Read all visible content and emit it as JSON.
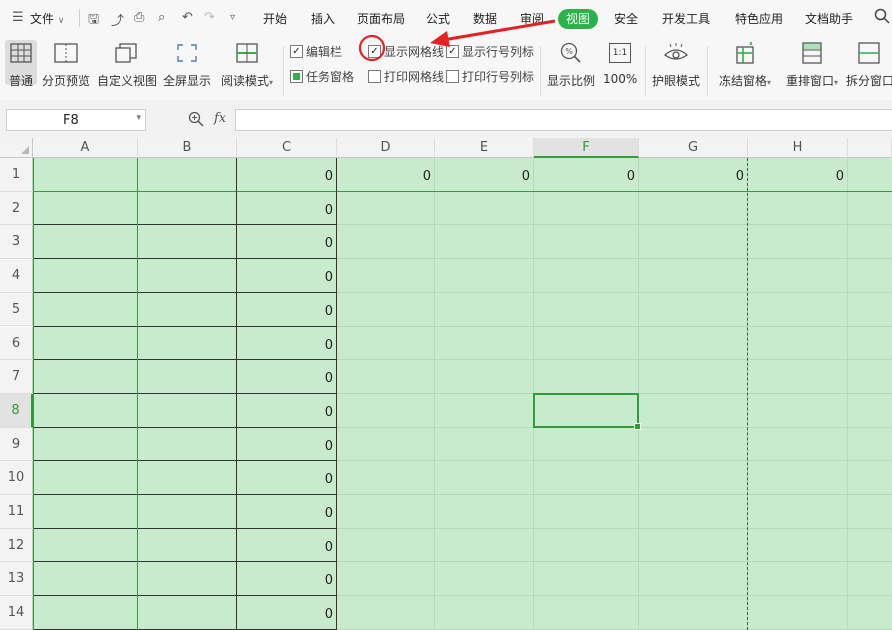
{
  "menubar": {
    "file_label": "文件",
    "tabs": [
      "开始",
      "插入",
      "页面布局",
      "公式",
      "数据",
      "审阅",
      "视图",
      "安全",
      "开发工具",
      "特色应用",
      "文档助手"
    ],
    "active_tab": "视图",
    "icons": [
      "menu-icon",
      "save-icon",
      "cloud-icon",
      "print-icon",
      "print-preview-icon",
      "undo-icon",
      "redo-icon",
      "customize-icon",
      "search-icon"
    ]
  },
  "ribbon": {
    "buttons": {
      "normal": "普通",
      "page_break": "分页预览",
      "custom_view": "自定义视图",
      "full_screen": "全屏显示",
      "reading_mode": "阅读模式",
      "zoom": "显示比例",
      "zoom_100": "100%",
      "eye_mode": "护眼模式",
      "freeze": "冻结窗格",
      "arrange": "重排窗口",
      "split": "拆分窗口"
    },
    "zoom_icon_text": "1:1",
    "checkboxes": {
      "formula_bar": {
        "label": "编辑栏",
        "checked": true
      },
      "show_gridlines": {
        "label": "显示网格线",
        "checked": true
      },
      "show_headers": {
        "label": "显示行号列标",
        "checked": true
      },
      "task_pane": {
        "label": "任务窗格",
        "checked": true
      },
      "print_gridlines": {
        "label": "打印网格线",
        "checked": false
      },
      "print_headers": {
        "label": "打印行号列标",
        "checked": false
      }
    }
  },
  "formula_bar": {
    "name_box": "F8",
    "fx_label": "fx",
    "formula": ""
  },
  "sheet": {
    "columns": [
      "A",
      "B",
      "C",
      "D",
      "E",
      "F",
      "G",
      "H"
    ],
    "rows": [
      "1",
      "2",
      "3",
      "4",
      "5",
      "6",
      "7",
      "8",
      "9",
      "10",
      "11",
      "12",
      "13",
      "14"
    ],
    "selected_cell": "F8",
    "selected_column": "F",
    "selected_row": "8",
    "row1_values": {
      "C": "0",
      "D": "0",
      "E": "0",
      "F": "0",
      "G": "0",
      "H": "0"
    },
    "col_c_values": [
      "0",
      "0",
      "0",
      "0",
      "0",
      "0",
      "0",
      "0",
      "0",
      "0",
      "0",
      "0",
      "0",
      "0"
    ]
  },
  "colors": {
    "accent": "#2bb34a",
    "cell_fill": "#c7ebcc",
    "annotation_red": "#e52222"
  }
}
